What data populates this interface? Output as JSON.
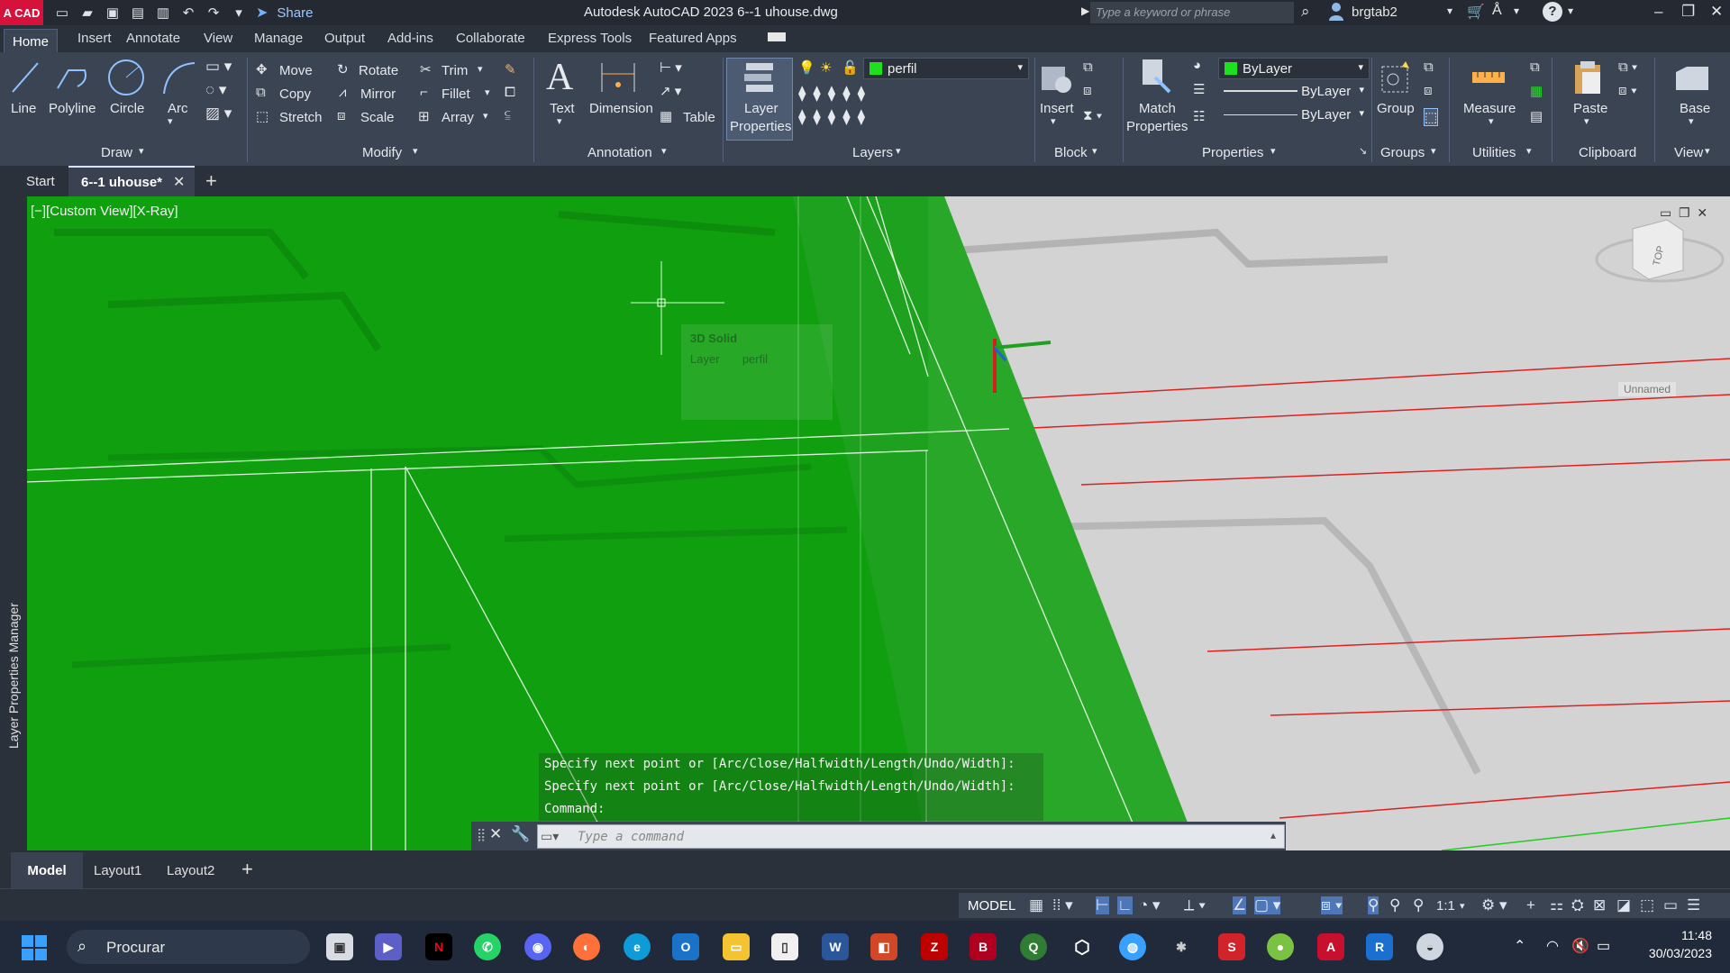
{
  "titlebar": {
    "logo": "A CAD",
    "share": "Share",
    "title": "Autodesk AutoCAD 2023    6--1 uhouse.dwg",
    "search_placeholder": "Type a keyword or phrase",
    "user": "brgtab2"
  },
  "ribbon_tabs": [
    "Home",
    "Insert",
    "Annotate",
    "View",
    "Manage",
    "Output",
    "Add-ins",
    "Collaborate",
    "Express Tools",
    "Featured Apps"
  ],
  "ribbon": {
    "draw": {
      "title": "Draw",
      "line": "Line",
      "polyline": "Polyline",
      "circle": "Circle",
      "arc": "Arc"
    },
    "modify": {
      "title": "Modify",
      "move": "Move",
      "rotate": "Rotate",
      "trim": "Trim",
      "copy": "Copy",
      "mirror": "Mirror",
      "fillet": "Fillet",
      "stretch": "Stretch",
      "scale": "Scale",
      "array": "Array"
    },
    "annotation": {
      "title": "Annotation",
      "text": "Text",
      "dimension": "Dimension",
      "table": "Table"
    },
    "layers": {
      "title": "Layers",
      "layer_props_1": "Layer",
      "layer_props_2": "Properties",
      "current_layer": "perfil"
    },
    "block": {
      "title": "Block",
      "insert": "Insert"
    },
    "properties": {
      "title": "Properties",
      "match_1": "Match",
      "match_2": "Properties",
      "color": "ByLayer",
      "linetype": "ByLayer",
      "lineweight": "ByLayer"
    },
    "groups": {
      "title": "Groups",
      "group": "Group"
    },
    "utilities": {
      "title": "Utilities",
      "measure": "Measure"
    },
    "clipboard": {
      "title": "Clipboard",
      "paste": "Paste"
    },
    "view": {
      "title": "View",
      "base": "Base"
    }
  },
  "doc_tabs": {
    "start": "Start",
    "active": "6--1 uhouse*"
  },
  "viewport": {
    "label": "[−][Custom View][X-Ray]",
    "viewcube_face": "TOP",
    "ucs_label": "Unnamed",
    "tooltip_title": "3D Solid",
    "tooltip_layer_key": "Layer",
    "tooltip_layer_val": "perfil",
    "side_palette": "Layer Properties Manager"
  },
  "command": {
    "history": [
      "Specify next point or [Arc/Close/Halfwidth/Length/Undo/Width]:",
      "Specify next point or [Arc/Close/Halfwidth/Length/Undo/Width]:",
      "Command:"
    ],
    "placeholder": "Type a command"
  },
  "layout_tabs": [
    "Model",
    "Layout1",
    "Layout2"
  ],
  "status": {
    "mode": "MODEL",
    "scale": "1:1"
  },
  "taskbar": {
    "search": "Procurar",
    "time": "11:48",
    "date": "30/03/2023"
  },
  "colors": {
    "accent_green": "#11a811",
    "ribbon_bg": "#3b4453",
    "layer_swatch": "#1ee11e"
  }
}
